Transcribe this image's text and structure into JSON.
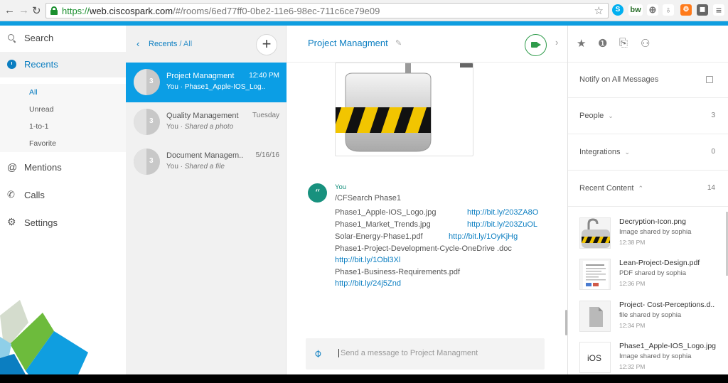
{
  "browser": {
    "url_scheme": "https://",
    "url_host": "web.ciscospark.com",
    "url_path": "/#/rooms/6ed77ff0-0be2-11e6-98ec-711c6ce79e09",
    "ext_bw": "bw"
  },
  "colors": {
    "brand_blue": "#0f9ee0",
    "selected_room": "#0b9ee5",
    "link": "#0b7ec1",
    "avatar_teal": "#18917e",
    "video_green": "#2e9b4a"
  },
  "nav": {
    "search": "Search",
    "recents": "Recents",
    "sub": [
      "All",
      "Unread",
      "1-to-1",
      "Favorite"
    ],
    "mentions": "Mentions",
    "calls": "Calls",
    "settings": "Settings"
  },
  "rooms": {
    "breadcrumb_a": "Recents",
    "breadcrumb_sep": " / ",
    "breadcrumb_b": "All",
    "items": [
      {
        "name": "Project Managment",
        "time": "12:40 PM",
        "who": "You · ",
        "last": "Phase1_Apple-IOS_Log..",
        "count": "3"
      },
      {
        "name": "Quality Management",
        "time": "Tuesday",
        "who": "You · ",
        "last": "Shared a photo",
        "count": "3"
      },
      {
        "name": "Document Managem..",
        "time": "5/16/16",
        "who": "You · ",
        "last": "Shared a file",
        "count": "3"
      }
    ]
  },
  "chat": {
    "title": "Project Managment",
    "sender": "You",
    "avatar_glyph": "“",
    "lines": {
      "cmd": "/CFSearch Phase1",
      "f1": "Phase1_Apple-IOS_Logo.jpg",
      "f1_link": "http://bit.ly/203ZA8O",
      "f2": "Phase1_Market_Trends.jpg",
      "f2_link": "http://bit.ly/203ZuOL",
      "f3": "Solar-Energy-Phase1.pdf",
      "f3_link": "http://bit.ly/1OyKjHg",
      "f4": "Phase1-Project-Development-Cycle-OneDrive .doc",
      "f4_link": "http://bit.ly/1Obl3Xl",
      "f5": "Phase1-Business-Requirements.pdf",
      "f5_link": "http://bit.ly/24j5Znd"
    },
    "composer_placeholder": "Send a message to Project Managment"
  },
  "right": {
    "notify": "Notify on All Messages",
    "people": "People",
    "people_count": "3",
    "integrations": "Integrations",
    "integrations_count": "0",
    "recent_content": "Recent Content",
    "recent_count": "14",
    "items": [
      {
        "name": "Decryption-Icon.png",
        "sub": "Image shared by sophia",
        "time": "12:38 PM"
      },
      {
        "name": "Lean-Project-Design.pdf",
        "sub": "PDF shared by sophia",
        "time": "12:36 PM"
      },
      {
        "name": "Project- Cost-Perceptions.d..",
        "sub": "file shared by sophia",
        "time": "12:34 PM"
      },
      {
        "name": "Phase1_Apple-IOS_Logo.jpg",
        "sub": "Image shared by sophia",
        "time": "12:32 PM",
        "thumb_text": "iOS"
      }
    ]
  }
}
